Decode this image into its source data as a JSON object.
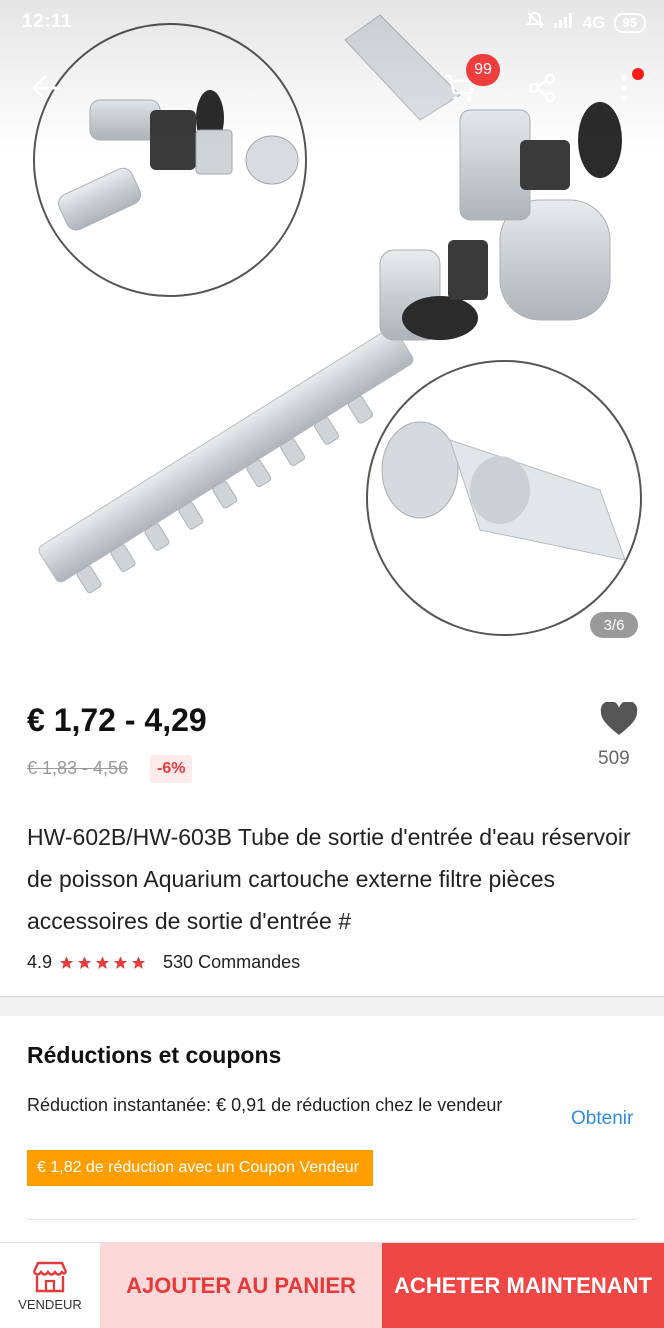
{
  "status_bar": {
    "time": "12:11",
    "network": "4G",
    "battery": "95"
  },
  "hero": {
    "image_counter": "3/6",
    "cart_badge": "99"
  },
  "product": {
    "price_range": "€ 1,72 - 4,29",
    "original_price": "€ 1,83 - 4,56",
    "discount": "-6%",
    "wishlist_count": "509",
    "title": "HW-602B/HW-603B Tube de sortie d'entrée d'eau réservoir de poisson Aquarium cartouche externe filtre pièces accessoires de sortie d'entrée #",
    "rating": "4.9",
    "rating_stars": 5,
    "orders": "530 Commandes"
  },
  "coupons": {
    "heading": "Réductions et coupons",
    "instant_discount": "Réduction instantanée: € 0,91 de réduction chez le vendeur",
    "obtain_label": "Obtenir",
    "coupon_tag": "€ 1,82 de réduction avec un Coupon Vendeur"
  },
  "bottom_bar": {
    "vendor_label": "VENDEUR",
    "add_to_cart": "AJOUTER AU PANIER",
    "buy_now": "ACHETER MAINTENANT"
  },
  "colors": {
    "accent_red": "#ef4646",
    "light_red": "#fdd8d8",
    "coupon_orange": "#ff9e00",
    "link_blue": "#2f8de0",
    "star_red": "#e43d3d"
  }
}
